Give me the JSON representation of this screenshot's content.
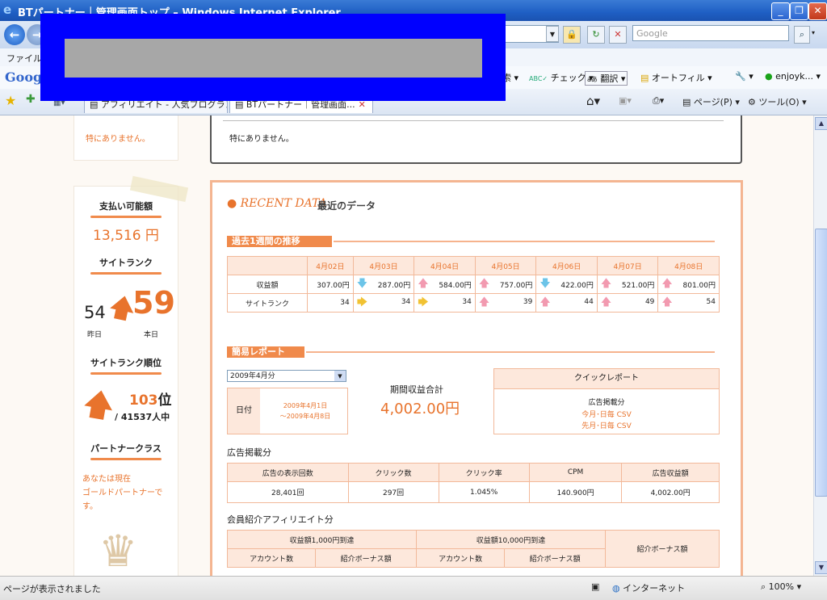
{
  "window": {
    "title": "BTパートナー｜管理画面トップ – Windows Internet Explorer",
    "min_label": "_",
    "max_label": "❐",
    "close_label": "✕"
  },
  "toolbar": {
    "search_placeholder": "Google",
    "menu_first": "ファイル(",
    "google_logo": "Googl"
  },
  "gbar": {
    "items": [
      "索 ▾",
      "チェック ▾",
      "翻訳 ▾",
      "オートフィル ▾",
      "enjoyk... ▾"
    ]
  },
  "tabs": [
    {
      "label": "アフィリエイト - 人気ブログラン..."
    },
    {
      "label": "BTパートナー｜管理画面..."
    }
  ],
  "cmdbar": {
    "page": "ページ(P) ▾",
    "tools": "ツール(O) ▾"
  },
  "status": {
    "left": "ページが表示されました",
    "zone": "インターネット",
    "zoom": "100%"
  },
  "left": {
    "notice": "特にありません。",
    "pay_label": "支払い可能額",
    "pay_value": "13,516 円",
    "rank_label": "サイトランク",
    "rank_yesterday": "54",
    "rank_today": "59",
    "yesterday_label": "昨日",
    "today_label": "本日",
    "order_label": "サイトランク順位",
    "order_value": "103",
    "order_unit": "位",
    "order_total": "/ 41537人中",
    "class_label": "パートナークラス",
    "class_text": "あなたは現在\nゴールドパートナーで\nす。"
  },
  "top_notice": "特にありません。",
  "recent": {
    "logo": "RECENT DATA",
    "title": "最近のデータ",
    "week_title": "過去1週間の推移",
    "dates": [
      "4月02日",
      "4月03日",
      "4月04日",
      "4月05日",
      "4月06日",
      "4月07日",
      "4月08日"
    ],
    "row1_label": "収益額",
    "row1": [
      {
        "dir": "",
        "v": "307.00円"
      },
      {
        "dir": "down",
        "v": "287.00円"
      },
      {
        "dir": "up",
        "v": "584.00円"
      },
      {
        "dir": "up",
        "v": "757.00円"
      },
      {
        "dir": "down",
        "v": "422.00円"
      },
      {
        "dir": "up",
        "v": "521.00円"
      },
      {
        "dir": "up",
        "v": "801.00円"
      }
    ],
    "row2_label": "サイトランク",
    "row2": [
      {
        "dir": "",
        "v": "34"
      },
      {
        "dir": "flat",
        "v": "34"
      },
      {
        "dir": "flat",
        "v": "34"
      },
      {
        "dir": "up",
        "v": "39"
      },
      {
        "dir": "up",
        "v": "44"
      },
      {
        "dir": "up",
        "v": "49"
      },
      {
        "dir": "up",
        "v": "54"
      }
    ]
  },
  "report": {
    "title": "簡易レポート",
    "month": "2009年4月分",
    "date_label": "日付",
    "date_range": "2009年4月1日\n～2009年4月8日",
    "total_label": "期間収益合計",
    "total_value": "4,002.00円",
    "quick_title": "クイックレポート",
    "quick_sub": "広告掲載分",
    "quick_l1": "今月･日毎  CSV",
    "quick_l2": "先月･日毎  CSV",
    "ad_title": "広告掲載分",
    "ad_headers": [
      "広告の表示回数",
      "クリック数",
      "クリック率",
      "CPM",
      "広告収益額"
    ],
    "ad_values": [
      "28,401回",
      "297回",
      "1.045%",
      "140.900円",
      "4,002.00円"
    ],
    "aff_title": "会員紹介アフィリエイト分",
    "aff_h1": "収益額1,000円到達",
    "aff_h2": "収益額10,000円到達",
    "aff_h3": "紹介ボーナス額",
    "aff_sub": [
      "アカウント数",
      "紹介ボーナス額",
      "アカウント数",
      "紹介ボーナス額"
    ]
  }
}
